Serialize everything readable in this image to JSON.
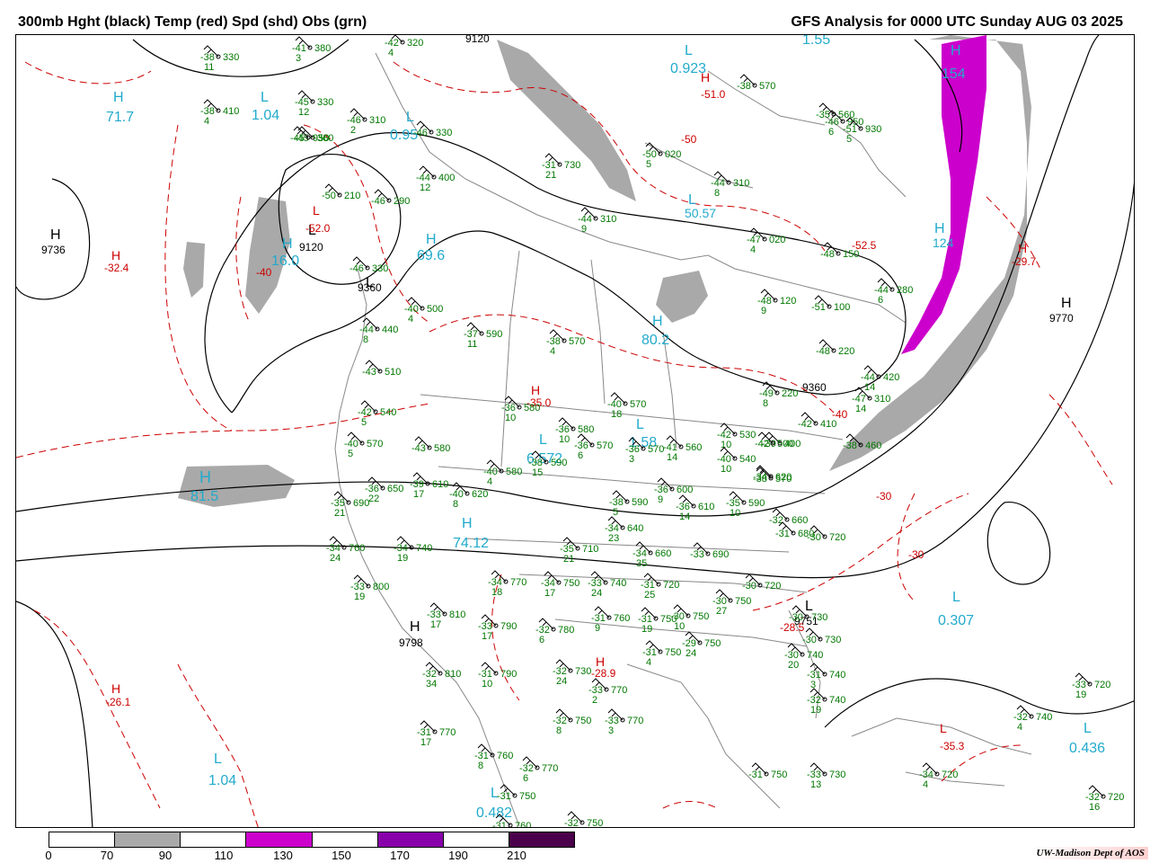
{
  "header": {
    "title_left": "300mb Hght (black) Temp (red) Spd (shd) Obs (grn)",
    "title_right": "GFS Analysis for 0000 UTC Sunday  AUG 03 2025"
  },
  "legend": {
    "ticks": [
      "0",
      "70",
      "90",
      "110",
      "130",
      "150",
      "170",
      "190",
      "210"
    ],
    "colors": [
      "#ffffff",
      "#a9a9a9",
      "#ffffff",
      "#cc00cc",
      "#ffffff",
      "#8800aa",
      "#ffffff",
      "#4a004a"
    ]
  },
  "credit": "UW-Madison  Dept of AOS",
  "colors": {
    "height_contour": "#000000",
    "temp_contour": "#cc0000",
    "obs": "#007700",
    "speed_label": "#22aacc",
    "land": "#888888"
  },
  "height_centers": [
    {
      "kind": "H",
      "value": "9736"
    },
    {
      "kind": "L",
      "value": "9120"
    },
    {
      "kind": "L",
      "value": "9360"
    },
    {
      "kind": "H",
      "value": "9770"
    },
    {
      "kind": "H",
      "value": "9798"
    },
    {
      "kind": "L",
      "value": "9751"
    }
  ],
  "contour_labels": [
    "9120",
    "9360",
    "9360"
  ],
  "temp_centers": [
    {
      "kind": "H",
      "value": "-32.4"
    },
    {
      "kind": "L",
      "value": "-52.0"
    },
    {
      "kind": "H",
      "value": "-51.0"
    },
    {
      "kind": "L",
      "value": "-50"
    },
    {
      "kind": "L",
      "value": "-52.5"
    },
    {
      "kind": "H",
      "value": "-29.7"
    },
    {
      "kind": "H",
      "value": "-35.0"
    },
    {
      "kind": "L",
      "value": "-28.5"
    },
    {
      "kind": "H",
      "value": "-28.9"
    },
    {
      "kind": "H",
      "value": "-26.1"
    },
    {
      "kind": "L",
      "value": "-35.3"
    },
    {
      "kind": "L",
      "value": "-40"
    }
  ],
  "temp_contour_labels": [
    "-40",
    "-30",
    "-30",
    "-40"
  ],
  "speed_centers": [
    {
      "kind": "H",
      "value": "71.7"
    },
    {
      "kind": "L",
      "value": "1.04"
    },
    {
      "kind": "L",
      "value": "0.95"
    },
    {
      "kind": "L",
      "value": "0.923"
    },
    {
      "kind": "H",
      "value": "1.55"
    },
    {
      "kind": "H",
      "value": "16.0"
    },
    {
      "kind": "H",
      "value": "69.6"
    },
    {
      "kind": "L",
      "value": "50.57"
    },
    {
      "kind": "H",
      "value": "80.2"
    },
    {
      "kind": "H",
      "value": "81.5"
    },
    {
      "kind": "L",
      "value": "6.572"
    },
    {
      "kind": "L",
      "value": "1.58"
    },
    {
      "kind": "H",
      "value": "74.12"
    },
    {
      "kind": "L",
      "value": "0.307"
    },
    {
      "kind": "L",
      "value": "0.436"
    },
    {
      "kind": "L",
      "value": "1.04"
    },
    {
      "kind": "L",
      "value": "0.482"
    },
    {
      "kind": "H",
      "value": "154"
    },
    {
      "kind": "H",
      "value": "124"
    }
  ],
  "observations": [
    {
      "temp": "-38",
      "hgt": "330",
      "spd": "11"
    },
    {
      "temp": "-41",
      "hgt": "380",
      "spd": "3"
    },
    {
      "temp": "-42",
      "hgt": "320",
      "spd": "4"
    },
    {
      "temp": "-38",
      "hgt": "410",
      "spd": "4"
    },
    {
      "temp": "-45",
      "hgt": "330",
      "spd": "12"
    },
    {
      "temp": "-46",
      "hgt": "310",
      "spd": "2"
    },
    {
      "temp": "-45",
      "hgt": "360",
      "spd": ""
    },
    {
      "temp": "-46",
      "hgt": "330",
      "spd": ""
    },
    {
      "temp": "-44",
      "hgt": "400",
      "spd": "12"
    },
    {
      "temp": "-50",
      "hgt": "210",
      "spd": ""
    },
    {
      "temp": "-46",
      "hgt": "290",
      "spd": ""
    },
    {
      "temp": "-46",
      "hgt": "330",
      "spd": ""
    },
    {
      "temp": "-40",
      "hgt": "500",
      "spd": "4"
    },
    {
      "temp": "-44",
      "hgt": "440",
      "spd": "8"
    },
    {
      "temp": "-43",
      "hgt": "510",
      "spd": ""
    },
    {
      "temp": "-42",
      "hgt": "540",
      "spd": "5"
    },
    {
      "temp": "-40",
      "hgt": "570",
      "spd": "5"
    },
    {
      "temp": "-43",
      "hgt": "580",
      "spd": ""
    },
    {
      "temp": "-36",
      "hgt": "650",
      "spd": "22"
    },
    {
      "temp": "-35",
      "hgt": "690",
      "spd": "21"
    },
    {
      "temp": "-39",
      "hgt": "610",
      "spd": "17"
    },
    {
      "temp": "-40",
      "hgt": "620",
      "spd": "8"
    },
    {
      "temp": "-34",
      "hgt": "760",
      "spd": "24"
    },
    {
      "temp": "-34",
      "hgt": "740",
      "spd": "19"
    },
    {
      "temp": "-33",
      "hgt": "800",
      "spd": "19"
    },
    {
      "temp": "-33",
      "hgt": "810",
      "spd": "17"
    },
    {
      "temp": "-33",
      "hgt": "790",
      "spd": "17"
    },
    {
      "temp": "-32",
      "hgt": "810",
      "spd": "34"
    },
    {
      "temp": "-31",
      "hgt": "790",
      "spd": "10"
    },
    {
      "temp": "-31",
      "hgt": "770",
      "spd": "17"
    },
    {
      "temp": "-31",
      "hgt": "760",
      "spd": "8"
    },
    {
      "temp": "-31",
      "hgt": "750",
      "spd": ""
    },
    {
      "temp": "-31",
      "hgt": "760",
      "spd": ""
    },
    {
      "temp": "-37",
      "hgt": "590",
      "spd": "11"
    },
    {
      "temp": "-38",
      "hgt": "570",
      "spd": "4"
    },
    {
      "temp": "-36",
      "hgt": "580",
      "spd": "10"
    },
    {
      "temp": "-36",
      "hgt": "580",
      "spd": "10"
    },
    {
      "temp": "-36",
      "hgt": "570",
      "spd": "6"
    },
    {
      "temp": "-40",
      "hgt": "580",
      "spd": "4"
    },
    {
      "temp": "-38",
      "hgt": "590",
      "spd": "15"
    },
    {
      "temp": "-40",
      "hgt": "570",
      "spd": "18"
    },
    {
      "temp": "-36",
      "hgt": "570",
      "spd": "3"
    },
    {
      "temp": "-41",
      "hgt": "560",
      "spd": "14"
    },
    {
      "temp": "-42",
      "hgt": "530",
      "spd": "10"
    },
    {
      "temp": "-40",
      "hgt": "540",
      "spd": "10"
    },
    {
      "temp": "-36",
      "hgt": "600",
      "spd": "9"
    },
    {
      "temp": "-38",
      "hgt": "590",
      "spd": "5"
    },
    {
      "temp": "-36",
      "hgt": "610",
      "spd": "14"
    },
    {
      "temp": "-35",
      "hgt": "590",
      "spd": "10"
    },
    {
      "temp": "-38",
      "hgt": "570",
      "spd": ""
    },
    {
      "temp": "-34",
      "hgt": "620",
      "spd": ""
    },
    {
      "temp": "-32",
      "hgt": "660",
      "spd": ""
    },
    {
      "temp": "-31",
      "hgt": "680",
      "spd": ""
    },
    {
      "temp": "-30",
      "hgt": "720",
      "spd": ""
    },
    {
      "temp": "-34",
      "hgt": "640",
      "spd": "23"
    },
    {
      "temp": "-35",
      "hgt": "710",
      "spd": "21"
    },
    {
      "temp": "-34",
      "hgt": "660",
      "spd": "35"
    },
    {
      "temp": "-33",
      "hgt": "690",
      "spd": ""
    },
    {
      "temp": "-34",
      "hgt": "770",
      "spd": "18"
    },
    {
      "temp": "-34",
      "hgt": "750",
      "spd": "17"
    },
    {
      "temp": "-33",
      "hgt": "740",
      "spd": "24"
    },
    {
      "temp": "-31",
      "hgt": "720",
      "spd": "25"
    },
    {
      "temp": "-30",
      "hgt": "750",
      "spd": "27"
    },
    {
      "temp": "-30",
      "hgt": "720",
      "spd": ""
    },
    {
      "temp": "-30",
      "hgt": "730",
      "spd": ""
    },
    {
      "temp": "-32",
      "hgt": "780",
      "spd": "6"
    },
    {
      "temp": "-31",
      "hgt": "760",
      "spd": "9"
    },
    {
      "temp": "-31",
      "hgt": "750",
      "spd": "19"
    },
    {
      "temp": "-30",
      "hgt": "750",
      "spd": "10"
    },
    {
      "temp": "-31",
      "hgt": "750",
      "spd": "4"
    },
    {
      "temp": "-29",
      "hgt": "750",
      "spd": "24"
    },
    {
      "temp": "-30",
      "hgt": "730",
      "spd": ""
    },
    {
      "temp": "-30",
      "hgt": "740",
      "spd": "20"
    },
    {
      "temp": "-31",
      "hgt": "740",
      "spd": "3"
    },
    {
      "temp": "-32",
      "hgt": "740",
      "spd": "19"
    },
    {
      "temp": "-32",
      "hgt": "730",
      "spd": "24"
    },
    {
      "temp": "-33",
      "hgt": "770",
      "spd": "2"
    },
    {
      "temp": "-32",
      "hgt": "750",
      "spd": "8"
    },
    {
      "temp": "-33",
      "hgt": "770",
      "spd": "3"
    },
    {
      "temp": "-32",
      "hgt": "770",
      "spd": "6"
    },
    {
      "temp": "-32",
      "hgt": "750",
      "spd": "5"
    },
    {
      "temp": "-31",
      "hgt": "750",
      "spd": ""
    },
    {
      "temp": "-33",
      "hgt": "730",
      "spd": "13"
    },
    {
      "temp": "-34",
      "hgt": "720",
      "spd": "4"
    },
    {
      "temp": "-33",
      "hgt": "720",
      "spd": "19"
    },
    {
      "temp": "-32",
      "hgt": "740",
      "spd": "4"
    },
    {
      "temp": "-32",
      "hgt": "720",
      "spd": "16"
    },
    {
      "temp": "-31",
      "hgt": "730",
      "spd": "21"
    },
    {
      "temp": "-44",
      "hgt": "310",
      "spd": "9"
    },
    {
      "temp": "-44",
      "hgt": "310",
      "spd": "8"
    },
    {
      "temp": "-50",
      "hgt": "020",
      "spd": "5"
    },
    {
      "temp": "-47",
      "hgt": "020",
      "spd": "4"
    },
    {
      "temp": "-48",
      "hgt": "120",
      "spd": "9"
    },
    {
      "temp": "-48",
      "hgt": "150",
      "spd": ""
    },
    {
      "temp": "-44",
      "hgt": "280",
      "spd": "6"
    },
    {
      "temp": "-51",
      "hgt": "100",
      "spd": ""
    },
    {
      "temp": "-48",
      "hgt": "220",
      "spd": ""
    },
    {
      "temp": "-49",
      "hgt": "220",
      "spd": "8"
    },
    {
      "temp": "-47",
      "hgt": "310",
      "spd": "14"
    },
    {
      "temp": "-44",
      "hgt": "420",
      "spd": "14"
    },
    {
      "temp": "-42",
      "hgt": "410",
      "spd": ""
    },
    {
      "temp": "-39",
      "hgt": "400",
      "spd": ""
    },
    {
      "temp": "-38",
      "hgt": "460",
      "spd": ""
    },
    {
      "temp": "-42",
      "hgt": "500",
      "spd": ""
    },
    {
      "temp": "-35",
      "hgt": "560",
      "spd": ""
    },
    {
      "temp": "-38",
      "hgt": "570",
      "spd": ""
    },
    {
      "temp": "-46",
      "hgt": "950",
      "spd": "6"
    },
    {
      "temp": "-51",
      "hgt": "930",
      "spd": "5"
    },
    {
      "temp": "-45",
      "hgt": "950",
      "spd": ""
    },
    {
      "temp": "-47",
      "hgt": "950",
      "spd": ""
    },
    {
      "temp": "-48",
      "hgt": "330",
      "spd": ""
    }
  ]
}
